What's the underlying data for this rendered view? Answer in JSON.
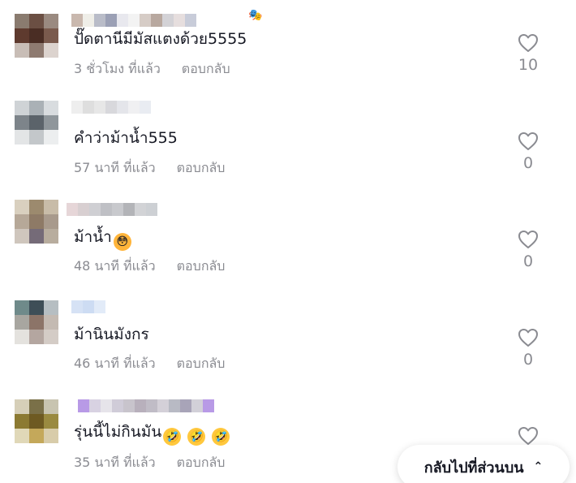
{
  "comments": [
    {
      "text": "ปั๊ดตานีมีมัสแตงด้วย5555",
      "time": "3 ชั่วโมง ที่แล้ว",
      "reply": "ตอบกลับ",
      "likes": "10",
      "emojis": []
    },
    {
      "text": "คำว่าม้าน้ำ555",
      "time": "57 นาที ที่แล้ว",
      "reply": "ตอบกลับ",
      "likes": "0",
      "emojis": []
    },
    {
      "text": "ม้าน้ำ",
      "time": "48 นาที ที่แล้ว",
      "reply": "ตอบกลับ",
      "likes": "0",
      "emojis": [
        "flushed-face-emoji"
      ]
    },
    {
      "text": "ม้านินมังกร",
      "time": "46 นาที ที่แล้ว",
      "reply": "ตอบกลับ",
      "likes": "0",
      "emojis": []
    },
    {
      "text": "รุ่นนี้ไม่กินมัน",
      "time": "35 นาที ที่แล้ว",
      "reply": "ตอบกลับ",
      "likes": "",
      "emojis": [
        "rolling-laughing-emoji",
        "rolling-laughing-emoji",
        "rolling-laughing-emoji"
      ]
    }
  ],
  "back_to_top": {
    "label": "กลับไปที่ส่วนบน",
    "icon": "double-chevron-up-icon"
  },
  "colors": {
    "text": "#161823",
    "secondary": "#8a8b91",
    "background": "#ffffff"
  }
}
